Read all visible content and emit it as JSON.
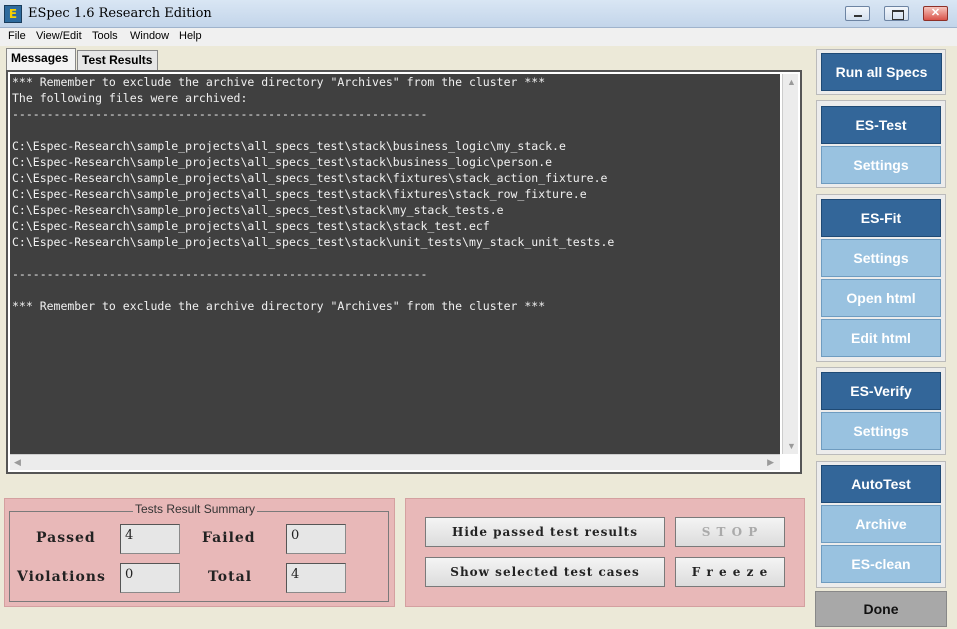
{
  "window": {
    "title": "ESpec 1.6 Research Edition",
    "icon": "espec-app-icon"
  },
  "menu": [
    "File",
    "View/Edit",
    "Tools",
    "Window",
    "Help"
  ],
  "tabs": [
    {
      "label": "Messages",
      "active": true
    },
    {
      "label": "Test Results",
      "active": false
    }
  ],
  "messages": [
    "*** Remember to exclude the archive directory \"Archives\" from the cluster ***",
    "The following files were archived:",
    "------------------------------------------------------------",
    "",
    "C:\\Espec-Research\\sample_projects\\all_specs_test\\stack\\business_logic\\my_stack.e",
    "C:\\Espec-Research\\sample_projects\\all_specs_test\\stack\\business_logic\\person.e",
    "C:\\Espec-Research\\sample_projects\\all_specs_test\\stack\\fixtures\\stack_action_fixture.e",
    "C:\\Espec-Research\\sample_projects\\all_specs_test\\stack\\fixtures\\stack_row_fixture.e",
    "C:\\Espec-Research\\sample_projects\\all_specs_test\\stack\\my_stack_tests.e",
    "C:\\Espec-Research\\sample_projects\\all_specs_test\\stack\\stack_test.ecf",
    "C:\\Espec-Research\\sample_projects\\all_specs_test\\stack\\unit_tests\\my_stack_unit_tests.e",
    "",
    "------------------------------------------------------------",
    "",
    "*** Remember to exclude the archive directory \"Archives\" from the cluster ***"
  ],
  "summary": {
    "title": "Tests Result Summary",
    "passed_label": "Passed",
    "passed_value": "4",
    "failed_label": "Failed",
    "failed_value": "0",
    "violations_label": "Violations",
    "violations_value": "0",
    "total_label": "Total",
    "total_value": "4"
  },
  "controls": {
    "hide_passed": "Hide passed test results",
    "stop": "S T O P",
    "show_selected": "Show selected test cases",
    "freeze": "F r e e z e"
  },
  "sidebar": {
    "run_all": "Run all Specs",
    "es_test": "ES-Test",
    "es_test_settings": "Settings",
    "es_fit": "ES-Fit",
    "es_fit_settings": "Settings",
    "open_html": "Open html",
    "edit_html": "Edit html",
    "es_verify": "ES-Verify",
    "es_verify_settings": "Settings",
    "autotest": "AutoTest",
    "archive": "Archive",
    "es_clean": "ES-clean",
    "done": "Done"
  },
  "colors": {
    "accent_dark": "#336699",
    "accent_light": "#99c2e0",
    "panel_pink": "#e8b8b8",
    "console_bg": "#404040"
  }
}
